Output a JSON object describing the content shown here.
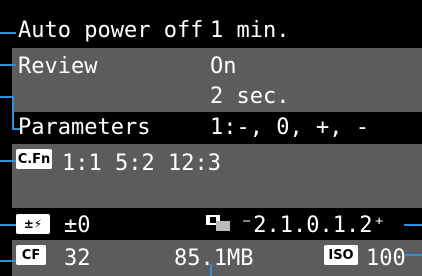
{
  "menu": {
    "auto_power_off": {
      "label": "Auto power off",
      "value": "1 min."
    },
    "review": {
      "label": "Review",
      "value_line1": "On",
      "value_line2": "2 sec."
    },
    "parameters": {
      "label": "Parameters",
      "value": "1:-, 0, +, -"
    },
    "custom_functions": {
      "icon_text": "C.Fn",
      "value": "1:1 5:2 12:3"
    }
  },
  "status": {
    "flash_comp": {
      "icon_text": "±0-icon-flash",
      "value": "±0"
    },
    "exposure": {
      "value": "⁻2.1.0.1.2⁺"
    },
    "card": {
      "icon_text": "CF",
      "shots": "32",
      "space": "85.1MB"
    },
    "iso": {
      "icon_text": "ISO",
      "value": "100"
    }
  },
  "colors": {
    "background": "#000000",
    "row_gray": "#5c5c5c",
    "text": "#ffffff",
    "leader_line": "#2f8fd8"
  }
}
